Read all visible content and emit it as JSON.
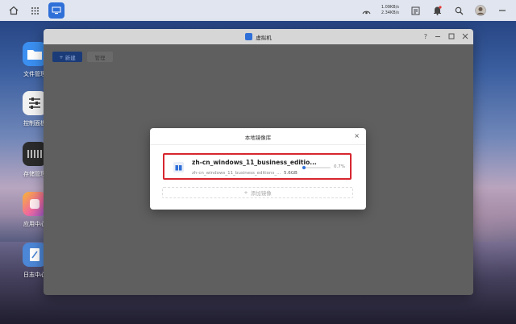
{
  "desktop": {
    "icons": [
      {
        "label": "文件管理"
      },
      {
        "label": "控制面板"
      },
      {
        "label": "存储管理"
      },
      {
        "label": "应用中心"
      },
      {
        "label": "日志中心"
      }
    ]
  },
  "taskbar": {
    "upload_speed": "1.09KB/s",
    "download_speed": "2.34KB/s"
  },
  "window": {
    "title": "虚拟机",
    "help_glyph": "?",
    "toolbar": {
      "new_label": "新建",
      "manage_label": "管理"
    }
  },
  "dialog": {
    "title": "本地镜像库",
    "close_glyph": "×",
    "item": {
      "name": "zh-cn_windows_11_business_editio...",
      "path": "zh-cn_windows_11_business_editions_...",
      "size": "5.6GB",
      "progress_text": "0.7%",
      "progress": 0.007
    },
    "add_label": "添加镜像"
  },
  "colors": {
    "accent": "#2f6fd8",
    "highlight_border": "#d7262f"
  }
}
